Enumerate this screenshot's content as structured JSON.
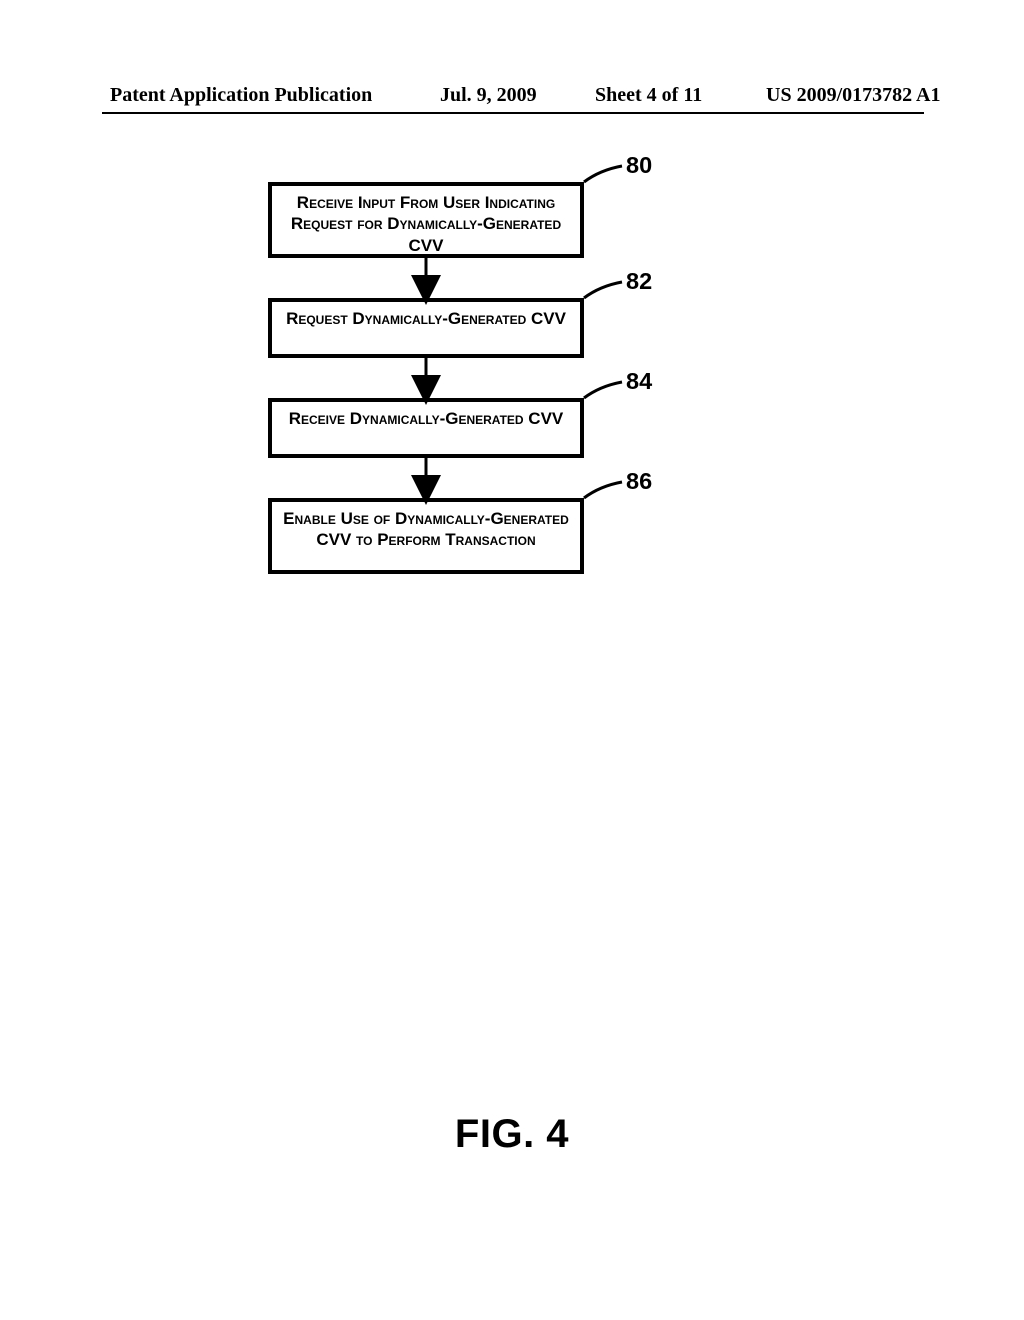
{
  "header": {
    "left": "Patent Application Publication",
    "date": "Jul. 9, 2009",
    "sheet": "Sheet 4 of 11",
    "docnum": "US 2009/0173782 A1"
  },
  "chart_data": {
    "type": "flowchart",
    "title": "FIG. 4",
    "nodes": [
      {
        "id": "80",
        "label": "Receive Input From User Indicating Request for Dynamically-Generated CVV"
      },
      {
        "id": "82",
        "label": "Request Dynamically-Generated CVV"
      },
      {
        "id": "84",
        "label": "Receive Dynamically-Generated CVV"
      },
      {
        "id": "86",
        "label": "Enable Use of Dynamically-Generated CVV to Perform Transaction"
      }
    ],
    "edges": [
      {
        "from": "80",
        "to": "82"
      },
      {
        "from": "82",
        "to": "84"
      },
      {
        "from": "84",
        "to": "86"
      }
    ]
  },
  "figure_label": "FIG. 4"
}
